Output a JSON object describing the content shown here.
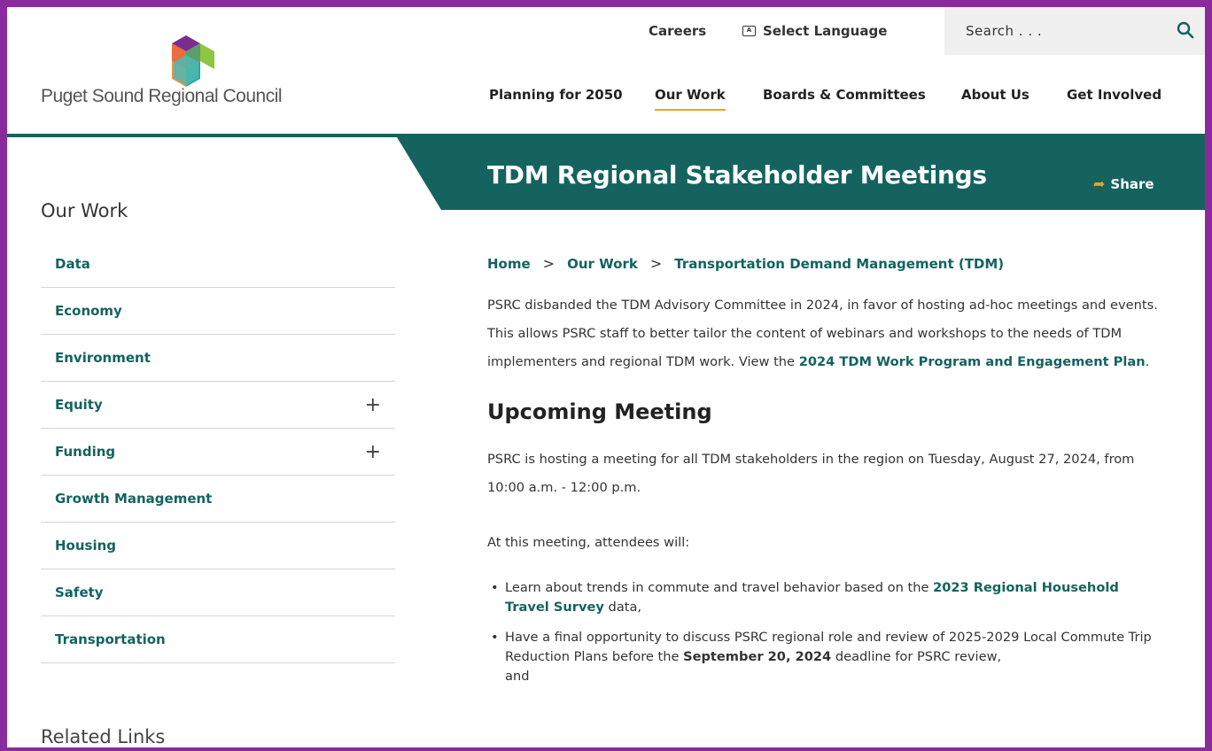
{
  "brand": {
    "logo_text": "Puget Sound Regional Council"
  },
  "utility": {
    "careers": "Careers",
    "language": "Select Language",
    "search_placeholder": "Search . . ."
  },
  "nav": {
    "items": [
      "Planning for 2050",
      "Our Work",
      "Boards & Committees",
      "About Us",
      "Get Involved"
    ],
    "active": "Our Work"
  },
  "page": {
    "title": "TDM Regional Stakeholder Meetings",
    "share": "Share"
  },
  "sidebar": {
    "title": "Our Work",
    "items": [
      {
        "label": "Data",
        "expandable": false
      },
      {
        "label": "Economy",
        "expandable": false
      },
      {
        "label": "Environment",
        "expandable": false
      },
      {
        "label": "Equity",
        "expandable": true
      },
      {
        "label": "Funding",
        "expandable": true
      },
      {
        "label": "Growth Management",
        "expandable": false
      },
      {
        "label": "Housing",
        "expandable": false
      },
      {
        "label": "Safety",
        "expandable": false
      },
      {
        "label": "Transportation",
        "expandable": false
      }
    ],
    "expand_symbol": "+",
    "related_title": "Related Links"
  },
  "breadcrumb": [
    "Home",
    "Our Work",
    "Transportation Demand Management (TDM)"
  ],
  "breadcrumb_sep": ">",
  "intro": {
    "text_before": "PSRC disbanded the TDM Advisory Committee in 2024, in favor of hosting ad-hoc meetings and events. This allows PSRC staff to better tailor the content of webinars and workshops to the needs of TDM implementers and regional TDM work. View the ",
    "link": "2024 TDM Work Program and Engagement Plan",
    "text_after": "."
  },
  "meeting": {
    "heading": "Upcoming Meeting",
    "details": "PSRC is hosting a meeting for all TDM stakeholders in the region on Tuesday, August 27, 2024, from 10:00 a.m. - 12:00 p.m.",
    "attendees_intro": "At this meeting, attendees will:",
    "bullet1_before": "Learn about trends in commute and travel behavior based on the ",
    "bullet1_link": "2023 Regional Household Travel Survey",
    "bullet1_after": " data,",
    "bullet2_before": "Have a final opportunity to discuss PSRC regional role and review of 2025-2029 Local Commute Trip Reduction Plans before the ",
    "bullet2_bold": "September 20, 2024",
    "bullet2_after": " deadline for PSRC review,",
    "bullet2_cut": "and"
  },
  "colors": {
    "teal": "#14635f",
    "accent": "#f0a21b",
    "frame": "#8a2a9c"
  }
}
